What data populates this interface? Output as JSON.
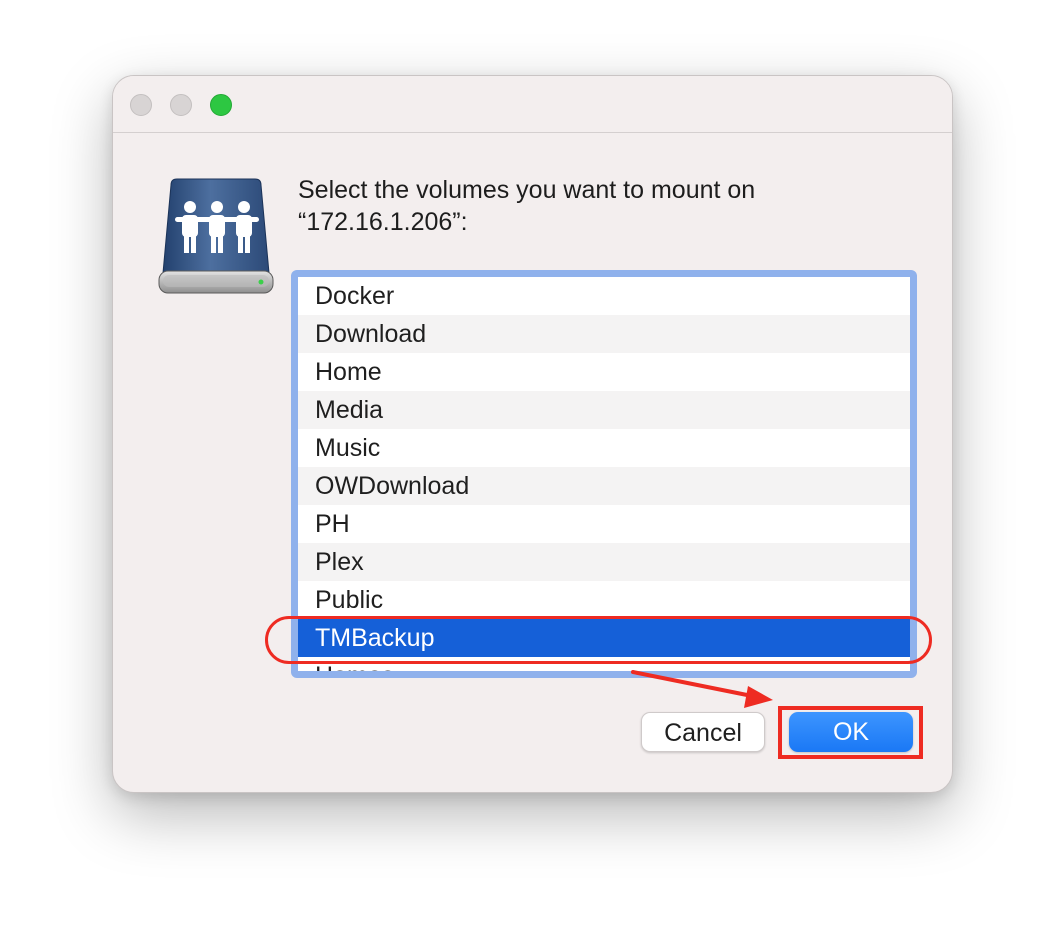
{
  "window": {
    "traffic_lights": [
      "close",
      "minimize",
      "zoom"
    ],
    "zoom_color": "#2dc742"
  },
  "dialog": {
    "icon": "network-server-icon",
    "prompt_line1": "Select the volumes you want to mount on",
    "prompt_line2": "“172.16.1.206”:"
  },
  "volumes": {
    "items": [
      {
        "label": "Docker",
        "selected": false
      },
      {
        "label": "Download",
        "selected": false
      },
      {
        "label": "Home",
        "selected": false
      },
      {
        "label": "Media",
        "selected": false
      },
      {
        "label": "Music",
        "selected": false
      },
      {
        "label": "OWDownload",
        "selected": false
      },
      {
        "label": "PH",
        "selected": false
      },
      {
        "label": "Plex",
        "selected": false
      },
      {
        "label": "Public",
        "selected": false
      },
      {
        "label": "TMBackup",
        "selected": true
      },
      {
        "label": "Homes",
        "selected": false
      }
    ],
    "selection_color": "#1560d8",
    "focus_ring_color": "#8fb1ec"
  },
  "buttons": {
    "cancel_label": "Cancel",
    "ok_label": "OK",
    "accent": "#1a78f5"
  },
  "annotations": {
    "color": "#ee2b22"
  }
}
